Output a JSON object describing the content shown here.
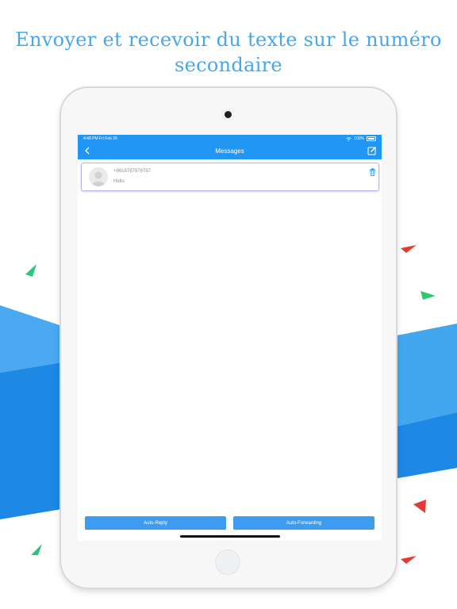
{
  "headline": {
    "line1": "Envoyer et recevoir du texte sur le numéro",
    "line2": "secondaire"
  },
  "colors": {
    "accent": "#2196f3",
    "headline": "#45a7ec",
    "band_light": "#43a7f0",
    "band_dark": "#1e88e5",
    "plane_green": "#2ec27e",
    "plane_red": "#e53935"
  },
  "status_bar": {
    "time": "4:48 PM  Fri Feb 26",
    "battery": "100%",
    "icons": [
      "wifi-icon",
      "battery-icon"
    ]
  },
  "nav": {
    "title": "Messages",
    "back_icon": "back-chevron-icon",
    "compose_icon": "compose-icon"
  },
  "messages": [
    {
      "number": "+8618787878787",
      "preview": "Hello",
      "avatar_icon": "avatar-placeholder-icon",
      "delete_icon": "trash-icon"
    }
  ],
  "actions": {
    "auto_reply": "Auto-Reply",
    "auto_forwarding": "Auto-Forwarding"
  }
}
